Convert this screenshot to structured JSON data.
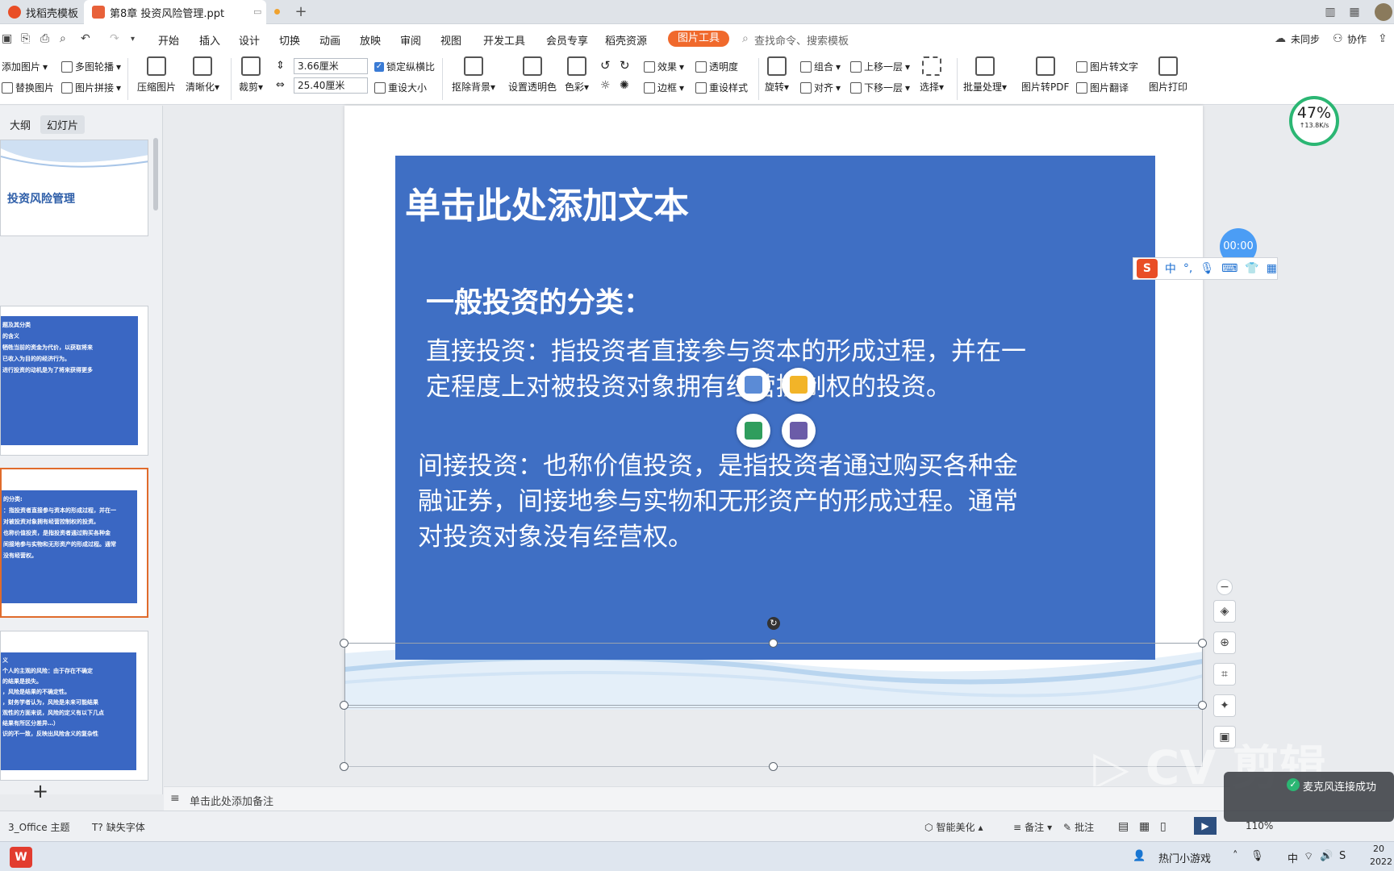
{
  "tabs": [
    {
      "label": "找稻壳模板"
    },
    {
      "label": "第8章 投资风险管理.ppt"
    }
  ],
  "menu": {
    "items": [
      "开始",
      "插入",
      "设计",
      "切换",
      "动画",
      "放映",
      "审阅",
      "视图",
      "开发工具",
      "会员专享",
      "稻壳资源"
    ],
    "active_tool": "图片工具",
    "search_placeholder": "查找命令、搜索模板",
    "sync": "未同步",
    "collab": "协作"
  },
  "ribbon": {
    "add_image": "添加图片",
    "multi_carousel": "多图轮播",
    "replace_image": "替换图片",
    "image_collage": "图片拼接",
    "compress": "压缩图片",
    "sharpen": "清晰化",
    "crop": "裁剪",
    "height_value": "3.66厘米",
    "width_value": "25.40厘米",
    "lock_ratio": "锁定纵横比",
    "reset_size": "重设大小",
    "remove_bg": "抠除背景",
    "set_transparent": "设置透明色",
    "color": "色彩",
    "effects": "效果",
    "transparency": "透明度",
    "border": "边框",
    "reset_style": "重设样式",
    "rotate": "旋转",
    "group": "组合",
    "align": "对齐",
    "bring_forward": "上移一层",
    "send_backward": "下移一层",
    "select": "选择",
    "batch": "批量处理",
    "to_pdf": "图片转PDF",
    "to_text": "图片转文字",
    "translate": "图片翻译",
    "print": "图片打印"
  },
  "panel": {
    "tab_outline": "大纲",
    "tab_slides": "幻灯片",
    "thumb1_title": "投资风险管理",
    "thumb2_lines": [
      "题及其分类",
      "的含义",
      "牺牲当前的资金为代价，以获取将来",
      "已收入为目的的经济行为。",
      "",
      "进行投资的动机是为了将来获得更多"
    ],
    "thumb3_lines": [
      "的分类:",
      "：指投资者直接参与资本的形成过程，并在一",
      "对被投资对象拥有经营控制权的投资。",
      "",
      "也称价值投资，是指投资者通过购买各种金",
      "间接地参与实物和无形资产的形成过程。通常",
      "没有经营权。"
    ],
    "thumb4_lines": [
      "义",
      "个人的主观的风险：由于存在不确定",
      "的结果是损失。",
      "，风险是结果的不确定性。",
      "，财务学者认为，风险是未来可能结果",
      "观性的方面来说，风险的定义有以下几点",
      "结果有所区分差异…）",
      "识的不一致，反映出风险含义的复杂性"
    ],
    "add_button": "+"
  },
  "slide": {
    "title": "单击此处添加文本",
    "heading": "一般投资的分类：",
    "para1_line1": "直接投资：指投资者直接参与资本的形成过程，并在一",
    "para1_line2": "定程度上对被投资对象拥有经营控制权的投资。",
    "para2_line1": "间接投资：也称价值投资，是指投资者通过购买各种金",
    "para2_line2": "融证券，间接地参与实物和无形资产的形成过程。通常",
    "para2_line3": "对投资对象没有经营权。"
  },
  "overlay": {
    "percent": "47%",
    "speed": "↑13.8K/s",
    "timer": "00:00",
    "ime_mode": "中",
    "toast": "麦克风连接成功",
    "watermark": "剪辑"
  },
  "notes": {
    "placeholder": "单击此处添加备注"
  },
  "status": {
    "theme": "3_Office 主题",
    "missing_font": "缺失字体",
    "smart": "智能美化",
    "notes": "备注",
    "comment": "批注",
    "zoom": "110%"
  },
  "taskbar": {
    "game": "热门小游戏",
    "lang": "中",
    "clock_a": "20",
    "clock_b": "2022"
  },
  "colors": {
    "slide_blue": "#3f6fc4",
    "accent_orange": "#f0692c",
    "progress_green": "#2bb673"
  }
}
